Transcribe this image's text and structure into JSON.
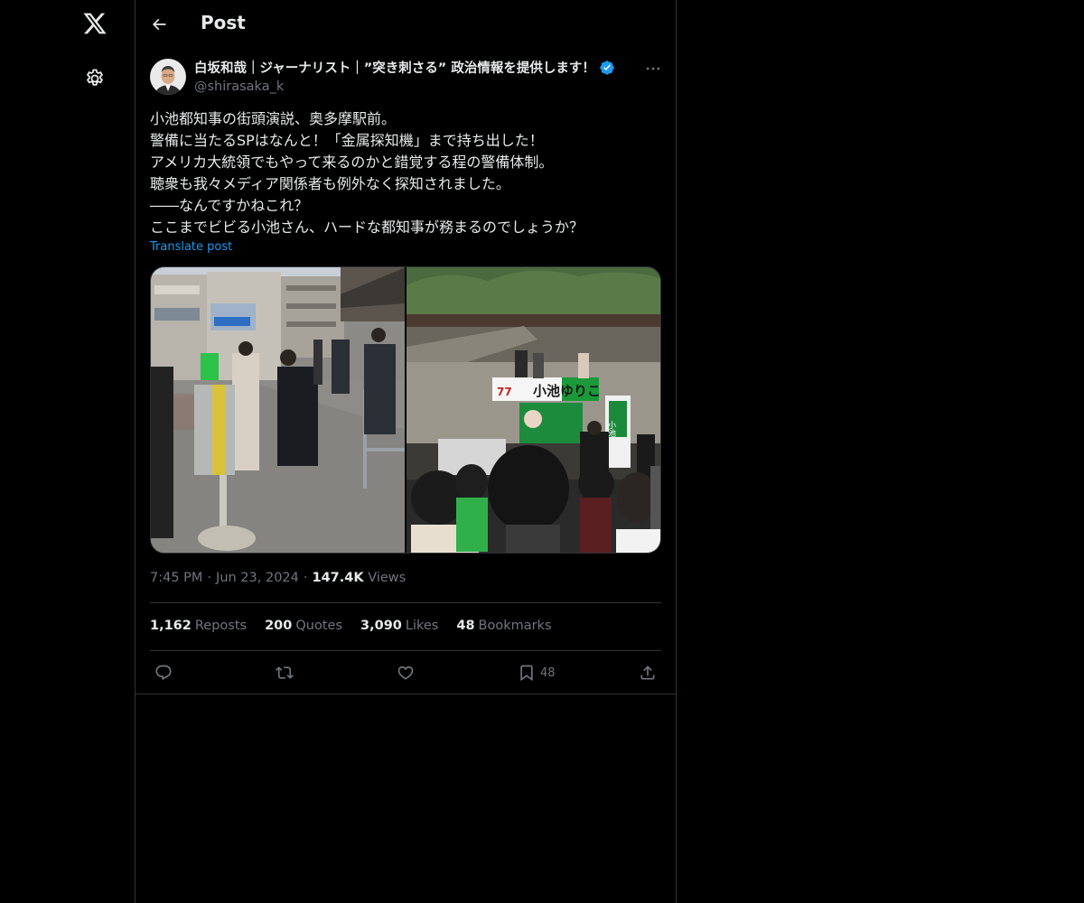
{
  "nav": {
    "logo_icon": "x-logo-icon",
    "settings_icon": "gear-icon"
  },
  "header": {
    "title": "Post"
  },
  "post": {
    "author_name": "白坂和哉｜ジャーナリスト｜”突き刺さる” 政治情報を提供します！",
    "handle": "@shirasaka_k",
    "lines": [
      "小池都知事の街頭演説、奥多摩駅前。",
      "警備に当たるSPはなんと！「金属探知機」まで持ち出した！",
      "アメリカ大統領でもやって来るのかと錯覚する程の警備体制。",
      "聴衆も我々メディア関係者も例外なく探知されました。",
      "――なんですかねこれ？",
      "ここまでビビる小池さん、ハードな都知事が務まるのでしょうか？"
    ],
    "translate_label": "Translate post",
    "time": "7:45 PM",
    "date": "Jun 23, 2024",
    "views_count": "147.4K",
    "views_label": "Views"
  },
  "stats": {
    "reposts_count": "1,162",
    "reposts_label": "Reposts",
    "quotes_count": "200",
    "quotes_label": "Quotes",
    "likes_count": "3,090",
    "likes_label": "Likes",
    "bookmarks_count": "48",
    "bookmarks_label": "Bookmarks"
  },
  "actions": {
    "bookmark_count": "48"
  },
  "photo_right_signs": {
    "banner": "小池ゆりこ",
    "number": "77",
    "poster_vertical": "小池"
  },
  "colors": {
    "background": "#000000",
    "text": "#e7e9ea",
    "muted": "#71767b",
    "link": "#1d9bf0",
    "border": "#2f3336",
    "verified": "#1d9bf0"
  }
}
